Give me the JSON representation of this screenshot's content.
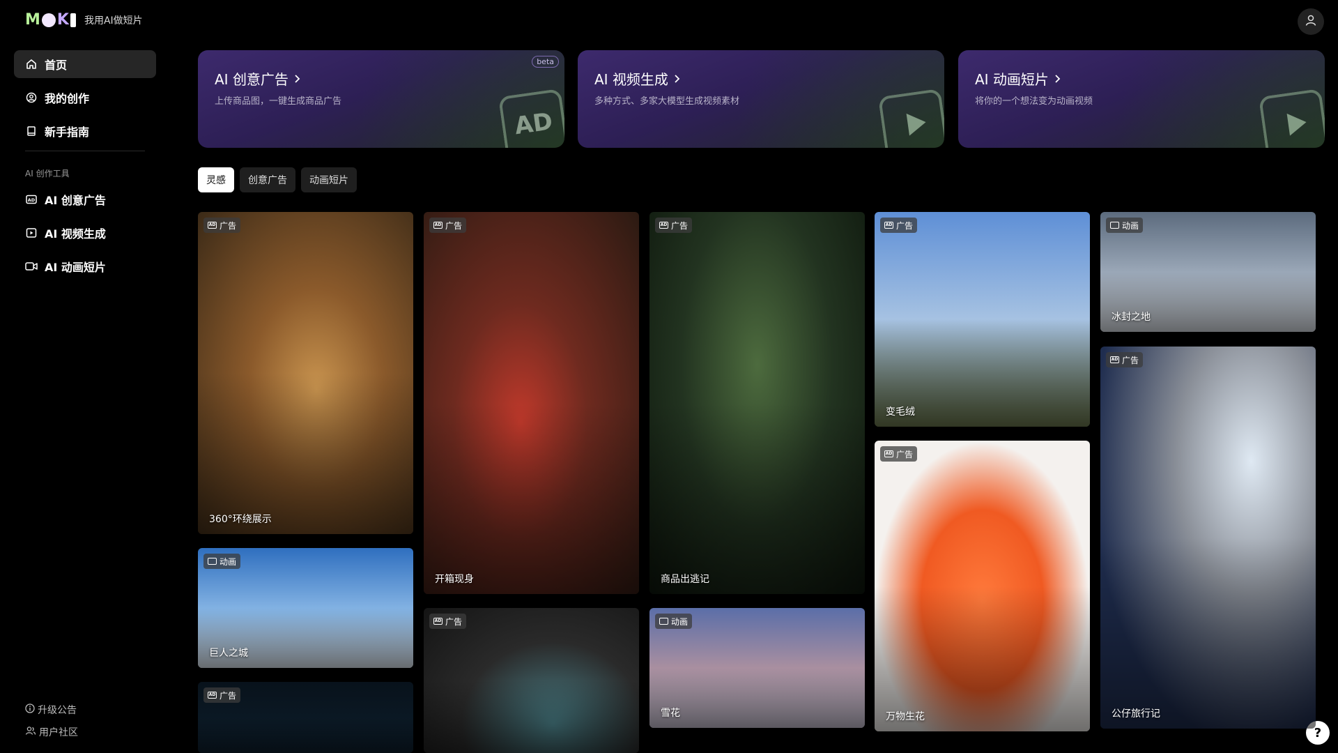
{
  "brand": {
    "logo_text": "MOKI",
    "tagline": "我用AI做短片"
  },
  "nav": [
    {
      "label": "首页",
      "icon": "home-icon",
      "active": true
    },
    {
      "label": "我的创作",
      "icon": "user-circle-icon",
      "active": false
    },
    {
      "label": "新手指南",
      "icon": "book-icon",
      "active": false
    }
  ],
  "tools_section_label": "AI 创作工具",
  "tools": [
    {
      "label": "AI 创意广告",
      "icon": "ad-icon"
    },
    {
      "label": "AI 视频生成",
      "icon": "play-square-icon"
    },
    {
      "label": "AI 动画短片",
      "icon": "video-camera-icon"
    }
  ],
  "bottom_links": [
    {
      "label": "升级公告",
      "icon": "info-icon"
    },
    {
      "label": "用户社区",
      "icon": "users-icon"
    }
  ],
  "features": [
    {
      "title": "AI 创意广告",
      "desc": "上传商品图，一键生成商品广告",
      "badge": "beta",
      "art": "AD"
    },
    {
      "title": "AI 视频生成",
      "desc": "多种方式、多家大模型生成视频素材",
      "badge": "",
      "art": "play"
    },
    {
      "title": "AI 动画短片",
      "desc": "将你的一个想法变为动画视频",
      "badge": "",
      "art": "play"
    }
  ],
  "tabs": [
    {
      "label": "灵感",
      "active": true
    },
    {
      "label": "创意广告",
      "active": false
    },
    {
      "label": "动画短片",
      "active": false
    }
  ],
  "cards": [
    {
      "badge": "广告",
      "title": "360°环绕展示"
    },
    {
      "badge": "动画",
      "title": "巨人之城"
    },
    {
      "badge": "广告",
      "title": ""
    },
    {
      "badge": "广告",
      "title": "开箱现身"
    },
    {
      "badge": "广告",
      "title": ""
    },
    {
      "badge": "广告",
      "title": "商品出逃记"
    },
    {
      "badge": "动画",
      "title": "雪花"
    },
    {
      "badge": "广告",
      "title": "变毛绒"
    },
    {
      "badge": "广告",
      "title": "万物生花"
    },
    {
      "badge": "动画",
      "title": "冰封之地"
    },
    {
      "badge": "广告",
      "title": "公仔旅行记"
    }
  ],
  "help_label": "?"
}
